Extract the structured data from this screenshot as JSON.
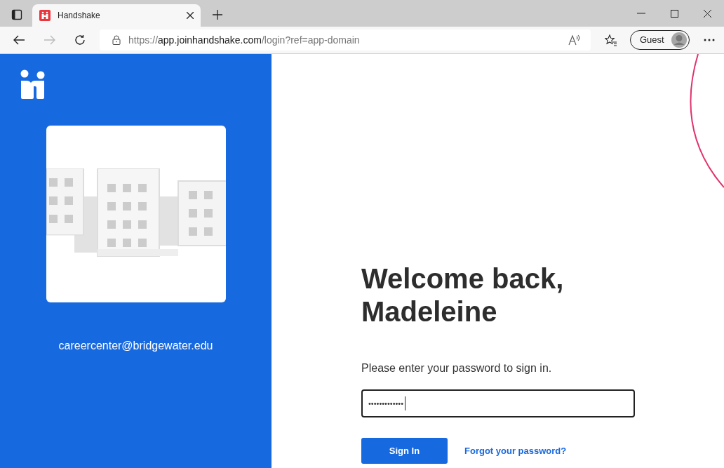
{
  "browser": {
    "tabs": [
      {
        "title": "Handshake",
        "selected": true
      }
    ],
    "address": "https://app.joinhandshake.com/login?ref=app-domain",
    "profile": "Guest"
  },
  "sidebar": {
    "email": "careercenter@bridgewater.edu"
  },
  "login": {
    "heading": "Welcome back, Madeleine",
    "prompt": "Please enter your password to sign in.",
    "password": {
      "value": "•••••••••••••"
    },
    "sign_in": "Sign In",
    "forgot_link": "Forgot your password?"
  }
}
